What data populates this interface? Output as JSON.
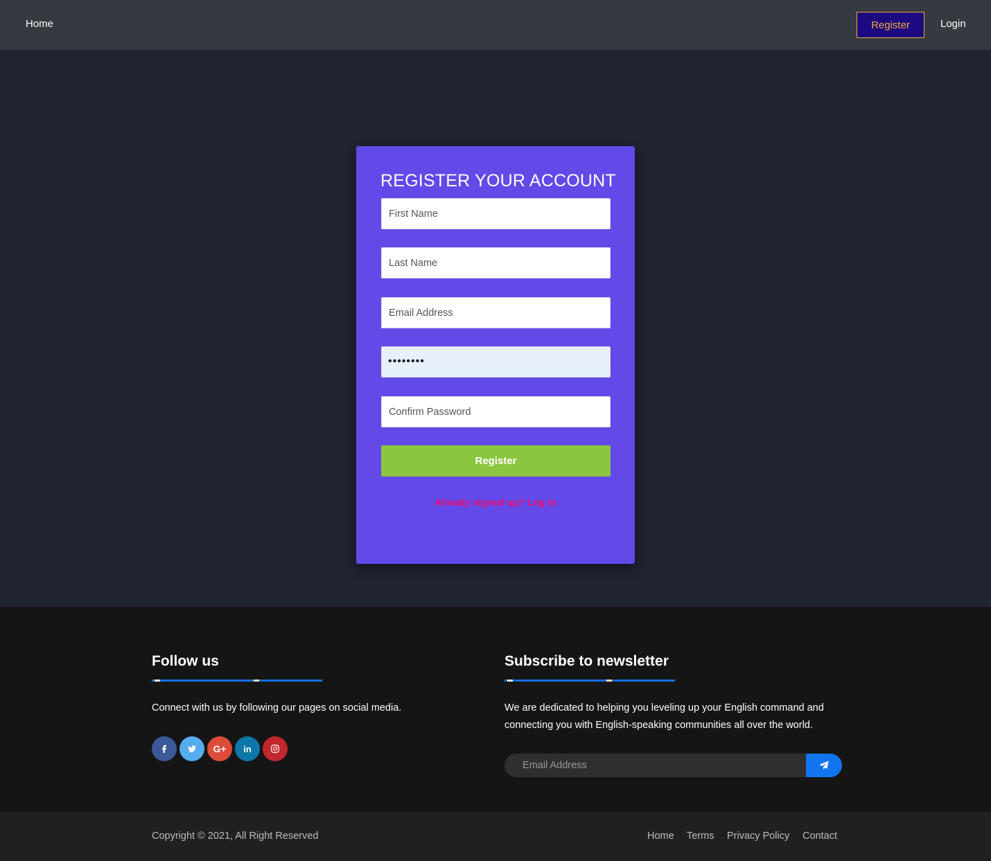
{
  "nav": {
    "home": "Home",
    "register": "Register",
    "login": "Login"
  },
  "form": {
    "title": "REGISTER YOUR ACCOUNT",
    "first_name_placeholder": "First Name",
    "last_name_placeholder": "Last Name",
    "email_placeholder": "Email Address",
    "password_value": "••••••••",
    "confirm_password_placeholder": "Confirm Password",
    "submit_label": "Register",
    "login_link": "Already signed up? Log in"
  },
  "footer": {
    "follow": {
      "title": "Follow us",
      "text": "Connect with us by following our pages on social media.",
      "icons": [
        {
          "name": "facebook-icon",
          "color": "#3b5998"
        },
        {
          "name": "twitter-icon",
          "color": "#55acee"
        },
        {
          "name": "google-plus-icon",
          "color": "#dd4b39"
        },
        {
          "name": "linkedin-icon",
          "color": "#0e76a8"
        },
        {
          "name": "instagram-icon",
          "color": "#c1272d"
        }
      ]
    },
    "newsletter": {
      "title": "Subscribe to newsletter",
      "text_line1": "We are dedicated to helping you leveling up your English command and",
      "text_line2": "connecting you with English-speaking communities all over the world.",
      "email_placeholder": "Email Address",
      "send_icon": "paper-plane-icon"
    }
  },
  "bottom": {
    "copyright": "Copyright © 2021, All Right Reserved",
    "links": [
      "Home",
      "Terms",
      "Privacy Policy",
      "Contact"
    ]
  }
}
